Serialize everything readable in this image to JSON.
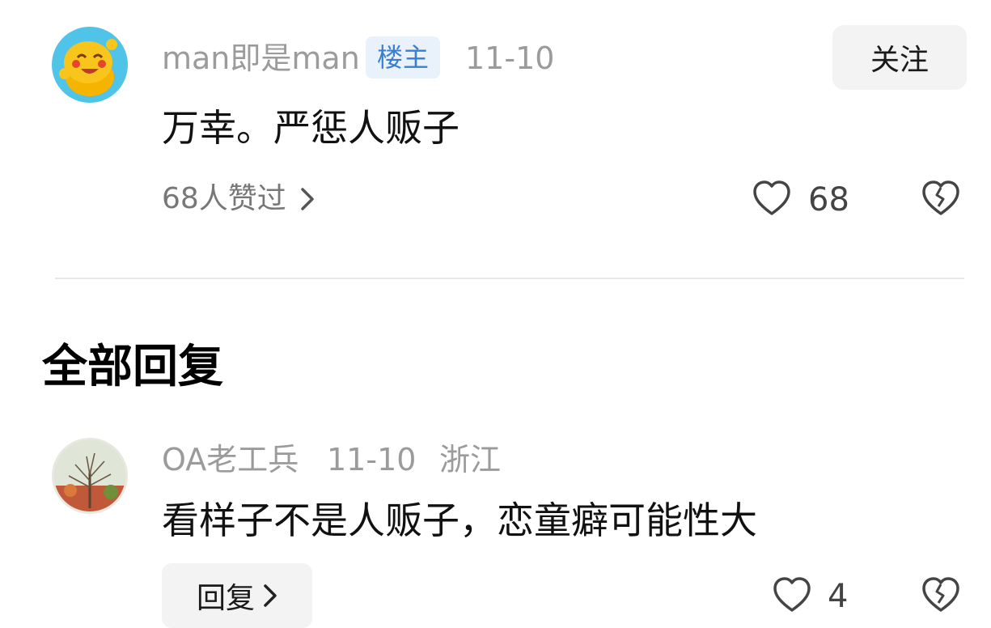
{
  "comment": {
    "username": "man即是man",
    "badge": "楼主",
    "date": "11-10",
    "follow_label": "关注",
    "text": "万幸。严惩人贩子",
    "likes_summary": "68人赞过",
    "like_count": "68"
  },
  "section_title": "全部回复",
  "reply": {
    "username": "OA老工兵",
    "date": "11-10",
    "location": "浙江",
    "text": "看样子不是人贩子，恋童癖可能性大",
    "reply_label": "回复",
    "like_count": "4"
  },
  "colors": {
    "badge_bg": "#e9f2fb",
    "badge_text": "#3a7fcf",
    "avatar1_bg": "#4fc3e8"
  }
}
